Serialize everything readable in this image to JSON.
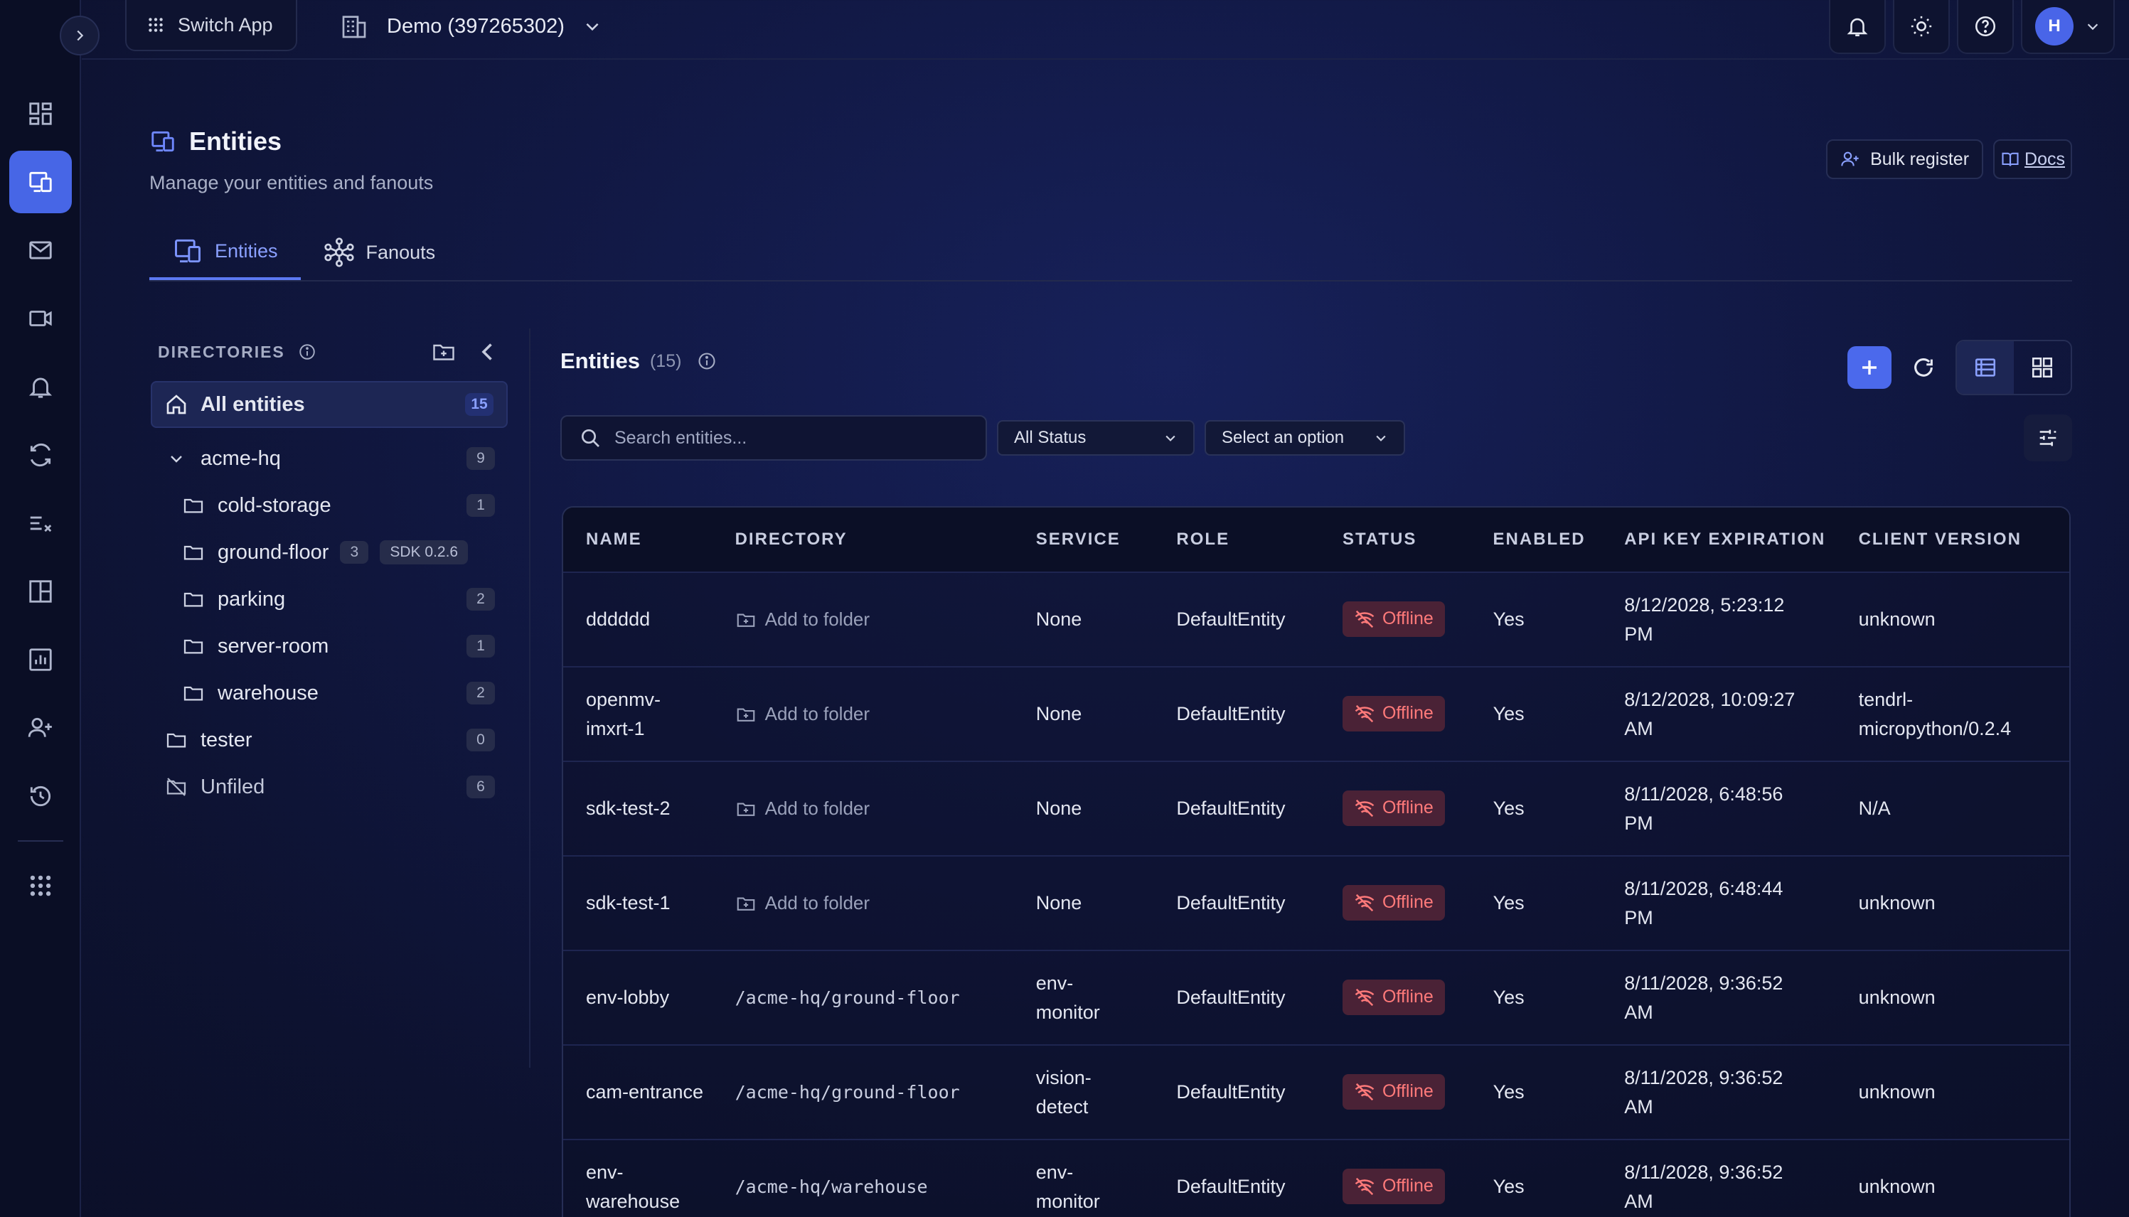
{
  "topbar": {
    "switch_app": "Switch App",
    "org": "Demo (397265302)",
    "avatar_initial": "H"
  },
  "nav": [
    "dashboard-icon",
    "entities-icon",
    "mail-icon",
    "video-icon",
    "bell-icon",
    "sync-icon",
    "rules-icon",
    "layout-icon",
    "report-icon",
    "add-user-icon",
    "history-icon",
    "apps-grid-icon"
  ],
  "header": {
    "title": "Entities",
    "subtitle": "Manage your entities and fanouts",
    "bulk_register": "Bulk register",
    "docs": "Docs"
  },
  "tabs": [
    {
      "label": "Entities",
      "active": true
    },
    {
      "label": "Fanouts",
      "active": false
    }
  ],
  "directories": {
    "label": "DIRECTORIES",
    "all": {
      "label": "All entities",
      "count": "15"
    },
    "root": {
      "label": "acme-hq",
      "count": "9"
    },
    "children": [
      {
        "label": "cold-storage",
        "count": "1"
      },
      {
        "label": "ground-floor",
        "count": "3",
        "badge": "SDK 0.2.6"
      },
      {
        "label": "parking",
        "count": "2"
      },
      {
        "label": "server-room",
        "count": "1"
      },
      {
        "label": "warehouse",
        "count": "2"
      }
    ],
    "tester": {
      "label": "tester",
      "count": "0"
    },
    "unfiled": {
      "label": "Unfiled",
      "count": "6"
    }
  },
  "entities": {
    "title": "Entities",
    "count": "(15)",
    "search_placeholder": "Search entities...",
    "status_filter": "All Status",
    "option_filter": "Select an option",
    "columns": [
      "NAME",
      "DIRECTORY",
      "SERVICE",
      "ROLE",
      "STATUS",
      "ENABLED",
      "API KEY EXPIRATION",
      "CLIENT VERSION"
    ],
    "rows": [
      {
        "name": "dddddd",
        "directory": "Add to folder",
        "dir_is_path": false,
        "service": "None",
        "role": "DefaultEntity",
        "status": "Offline",
        "enabled": "Yes",
        "api_l1": "8/12/2028, 5:23:12",
        "api_l2": "PM",
        "ver_l1": "unknown",
        "ver_l2": ""
      },
      {
        "name": "openmv-",
        "name_l2": "imxrt-1",
        "directory": "Add to folder",
        "dir_is_path": false,
        "service": "None",
        "role": "DefaultEntity",
        "status": "Offline",
        "enabled": "Yes",
        "api_l1": "8/12/2028, 10:09:27",
        "api_l2": "AM",
        "ver_l1": "tendrl-",
        "ver_l2": "micropython/0.2.4"
      },
      {
        "name": "sdk-test-2",
        "directory": "Add to folder",
        "dir_is_path": false,
        "service": "None",
        "role": "DefaultEntity",
        "status": "Offline",
        "enabled": "Yes",
        "api_l1": "8/11/2028, 6:48:56",
        "api_l2": "PM",
        "ver_l1": "N/A",
        "ver_l2": ""
      },
      {
        "name": "sdk-test-1",
        "directory": "Add to folder",
        "dir_is_path": false,
        "service": "None",
        "role": "DefaultEntity",
        "status": "Offline",
        "enabled": "Yes",
        "api_l1": "8/11/2028, 6:48:44",
        "api_l2": "PM",
        "ver_l1": "unknown",
        "ver_l2": ""
      },
      {
        "name": "env-lobby",
        "directory": "/acme-hq/ground-floor",
        "dir_is_path": true,
        "service": "env-",
        "service_l2": "monitor",
        "role": "DefaultEntity",
        "status": "Offline",
        "enabled": "Yes",
        "api_l1": "8/11/2028, 9:36:52",
        "api_l2": "AM",
        "ver_l1": "unknown",
        "ver_l2": ""
      },
      {
        "name": "cam-entrance",
        "directory": "/acme-hq/ground-floor",
        "dir_is_path": true,
        "service": "vision-",
        "service_l2": "detect",
        "role": "DefaultEntity",
        "status": "Offline",
        "enabled": "Yes",
        "api_l1": "8/11/2028, 9:36:52",
        "api_l2": "AM",
        "ver_l1": "unknown",
        "ver_l2": ""
      },
      {
        "name": "env-",
        "name_l2": "warehouse",
        "directory": "/acme-hq/warehouse",
        "dir_is_path": true,
        "service": "env-",
        "service_l2": "monitor",
        "role": "DefaultEntity",
        "status": "Offline",
        "enabled": "Yes",
        "api_l1": "8/11/2028, 9:36:52",
        "api_l2": "AM",
        "ver_l1": "unknown",
        "ver_l2": ""
      }
    ]
  },
  "colors": {
    "accent": "#4b69ec",
    "offline_text": "#ff7a7a",
    "offline_bg": "#4a2236",
    "background": "#111843"
  }
}
